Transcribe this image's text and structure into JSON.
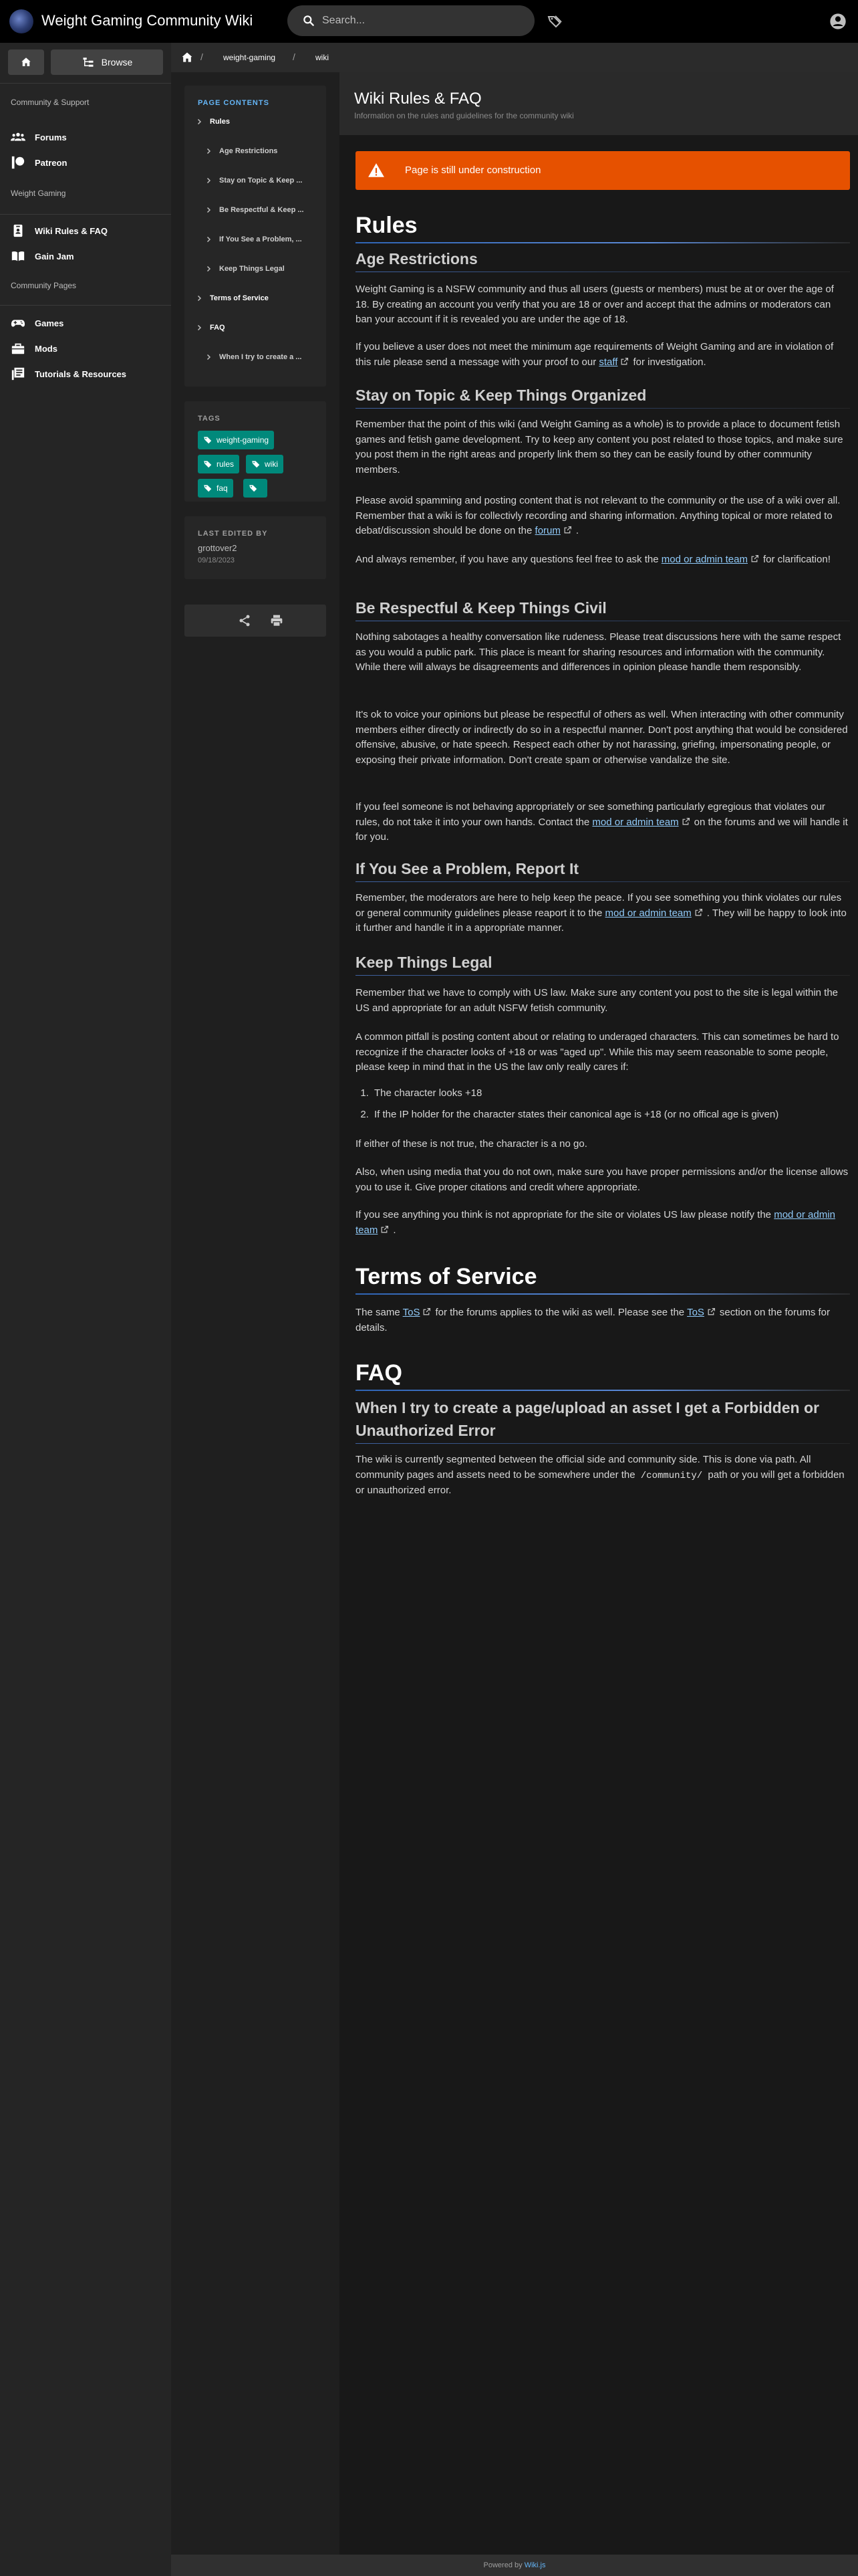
{
  "header": {
    "site_title": "Weight Gaming Community Wiki",
    "search_placeholder": "Search..."
  },
  "nav": {
    "browse_label": "Browse",
    "section_community": "Community & Support",
    "forums": "Forums",
    "patreon": "Patreon",
    "section_weight_gaming": "Weight Gaming",
    "wiki_rules": "Wiki Rules & FAQ",
    "gain_jam": "Gain Jam",
    "section_community_pages": "Community Pages",
    "games": "Games",
    "mods": "Mods",
    "tutorials": "Tutorials & Resources"
  },
  "breadcrumb": {
    "items": [
      "weight-gaming",
      "wiki"
    ]
  },
  "toc": {
    "label": "PAGE CONTENTS",
    "items": [
      "Rules",
      "Age Restrictions",
      "Stay on Topic & Keep ...",
      "Be Respectful & Keep ...",
      "If You See a Problem, ...",
      "Keep Things Legal",
      "Terms of Service",
      "FAQ",
      "When I try to create a ..."
    ]
  },
  "tags": {
    "label": "TAGS",
    "items": [
      "weight-gaming",
      "rules",
      "wiki",
      "faq",
      ""
    ]
  },
  "edited": {
    "label": "LAST EDITED BY",
    "user": "grottover2",
    "date": "09/18/2023"
  },
  "page": {
    "title": "Wiki Rules & FAQ",
    "description": "Information on the rules and guidelines for the community wiki",
    "warning": "Page is still under construction"
  },
  "content": {
    "rules_h": "Rules",
    "age_h": "Age Restrictions",
    "age_p1": "Weight Gaming is a NSFW community and thus all users (guests or members) must be at or over the age of 18. By creating an account you verify that you are 18 or over and accept that the admins or moderators can ban your account if it is revealed you are under the age of 18.",
    "age_p2_a": "If you believe a user does not meet the minimum age requirements of Weight Gaming and are in violation of this rule please send a message with your proof to our",
    "age_p2_link": "staff",
    "age_p2_b": "for investigation.",
    "topic_h": "Stay on Topic & Keep Things Organized",
    "topic_p1": "Remember that the point of this wiki (and Weight Gaming as a whole) is to provide a place to document fetish games and fetish game development. Try to keep any content you post related to those topics, and make sure you post them in the right areas and properly link them so they can be easily found by other community members.",
    "topic_p2_a": "Please avoid spamming and posting content that is not relevant to the community or the use of a wiki over all. Remember that a wiki is for collectivly recording and sharing information. Anything topical or more related to debat/discussion should be done on the",
    "topic_p2_link": "forum",
    "topic_p2_b": ".",
    "topic_p3_a": "And always remember, if you have any questions feel free to ask the",
    "topic_p3_link": "mod or admin team",
    "topic_p3_b": "for clarification!",
    "civil_h": "Be Respectful & Keep Things Civil",
    "civil_p1": "Nothing sabotages a healthy conversation like rudeness. Please treat discussions here with the same respect as you would a public park. This place is meant for sharing resources and information with the community. While there will always be disagreements and differences in opinion please handle them responsibly.",
    "civil_p2": "It's ok to voice your opinions but please be respectful of others as well. When interacting with other community members either directly or indirectly do so in a respectful manner. Don't post anything that would be considered offensive, abusive, or hate speech. Respect each other by not harassing, griefing, impersonating people, or exposing their private information. Don't create spam or otherwise vandalize the site.",
    "civil_p3_a": "If you feel someone is not behaving appropriately or see something particularly egregious that violates our rules, do not take it into your own hands. Contact the",
    "civil_p3_link": "mod or admin team",
    "civil_p3_b": "on the forums and we will handle it for you.",
    "report_h": "If You See a Problem, Report It",
    "report_p_a": "Remember, the moderators are here to help keep the peace. If you see something you think violates our rules or general community guidelines please reaport it to the",
    "report_p_link": "mod or admin team",
    "report_p_b": ". They will be happy to look into it further and handle it in a appropriate manner.",
    "legal_h": "Keep Things Legal",
    "legal_p1": "Remember that we have to comply with US law. Make sure any content you post to the site is legal within the US and appropriate for an adult NSFW fetish community.",
    "legal_p2": "A common pitfall is posting content about or relating to underaged characters. This can sometimes be hard to recognize if the character looks of +18 or was \"aged up\". While this may seem reasonable to some people, please keep in mind that in the US the law only really cares if:",
    "legal_list": [
      "The character looks +18",
      "If the IP holder for the character states their canonical age is +18 (or no offical age is given)"
    ],
    "legal_p3": "If either of these is not true, the character is a no go.",
    "legal_p4": "Also, when using media that you do not own, make sure you have proper permissions and/or the license allows you to use it. Give proper citations and credit where appropriate.",
    "legal_p5_a": "If you see anything you think is not appropriate for the site or violates US law please notify the",
    "legal_p5_link": "mod or admin team",
    "legal_p5_b": ".",
    "tos_h": "Terms of Service",
    "tos_p_a": "The same",
    "tos_p_link1": "ToS",
    "tos_p_b": "for the forums applies to the wiki as well. Please see the",
    "tos_p_link2": "ToS",
    "tos_p_c": "section on the forums for details.",
    "faq_h": "FAQ",
    "faq_q": "When I try to create a page/upload an asset I get a Forbidden or Unauthorized Error",
    "faq_p_a": "The wiki is currently segmented between the official side and community side. This is done via path. All community pages and assets need to be somewhere under the",
    "faq_p_code": "/community/",
    "faq_p_b": "path or you will get a forbidden or unauthorized error."
  },
  "footer": {
    "powered_by": "Powered by",
    "wikijs": "Wiki.js"
  }
}
